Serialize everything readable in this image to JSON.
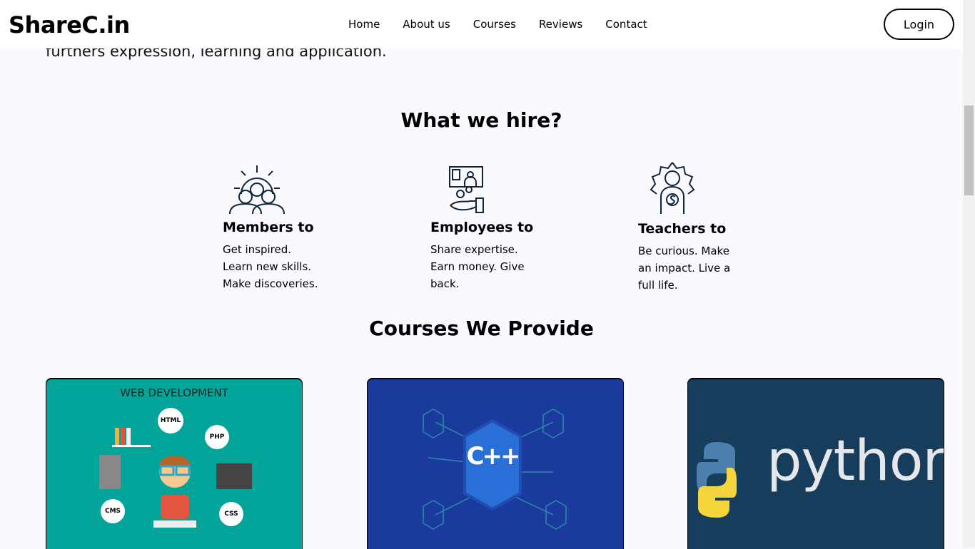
{
  "nav": {
    "logo": "ShareC.in",
    "links": [
      "Home",
      "About us",
      "Courses",
      "Reviews",
      "Contact"
    ],
    "login": "Login"
  },
  "intro": "furthers expression, learning and application.",
  "hire": {
    "title": "What we hire?",
    "items": [
      {
        "title": "Members to",
        "text": "Get inspired. Learn new skills. Make discoveries."
      },
      {
        "title": "Employees to",
        "text": "Share expertise. Earn money. Give back."
      },
      {
        "title": "Teachers to",
        "text": "Be curious. Make an impact. Live a full life."
      }
    ]
  },
  "courses": {
    "title": "Courses We Provide",
    "cards": [
      {
        "image_text": "WEB DEVELOPMENT",
        "tags": [
          "HTML",
          "PHP",
          "CMS",
          "CSS"
        ],
        "color": "#03a59b"
      },
      {
        "image_text": "C++",
        "color": "#1b3a9e"
      },
      {
        "image_text": "python",
        "color": "#163d5c"
      }
    ]
  }
}
